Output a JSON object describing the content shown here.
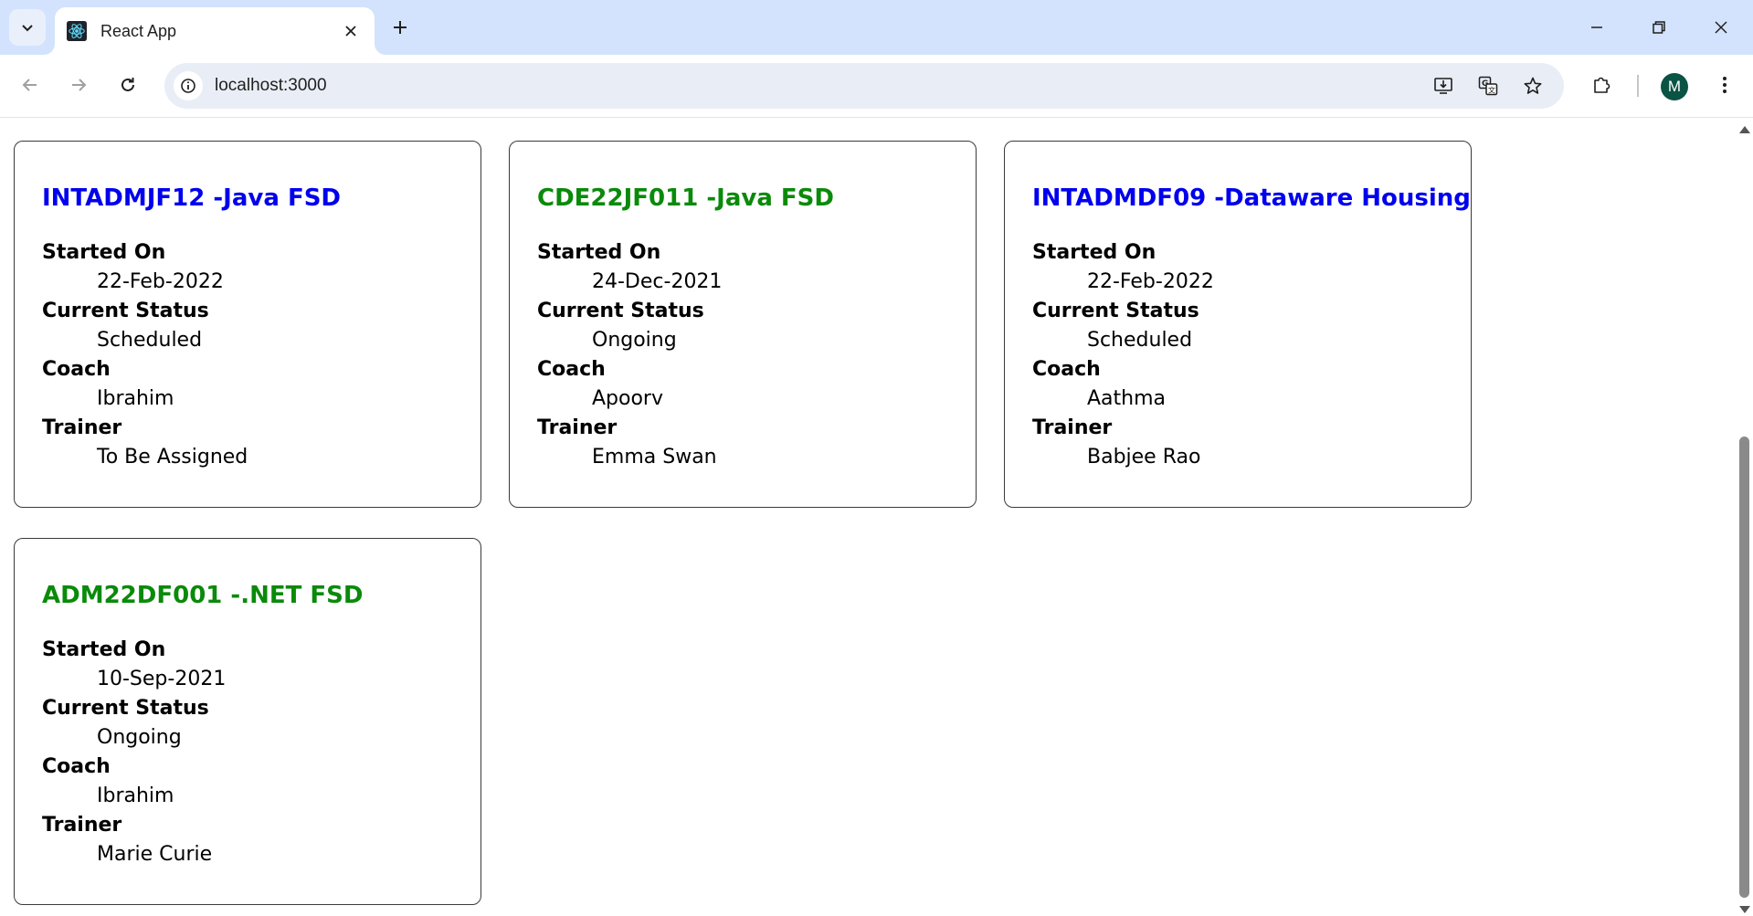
{
  "browser": {
    "tab": {
      "title": "React App",
      "favicon": "react-atom-icon"
    },
    "url": "localhost:3000",
    "profile_initial": "M",
    "colors": {
      "tabstrip": "#d3e3fd",
      "omnibox": "#e9eef6",
      "avatar": "#0b5345"
    }
  },
  "labels": {
    "started_on": "Started On",
    "current_status": "Current Status",
    "coach": "Coach",
    "trainer": "Trainer"
  },
  "cohorts": [
    {
      "code": "INTADMJF12",
      "title": "INTADMJF12 -Java FSD",
      "title_color": "#0000ee",
      "started_on": "22-Feb-2022",
      "status": "Scheduled",
      "coach": "Ibrahim",
      "trainer": "To Be Assigned"
    },
    {
      "code": "CDE22JF011",
      "title": "CDE22JF011 -Java FSD",
      "title_color": "#0a8a0a",
      "started_on": "24-Dec-2021",
      "status": "Ongoing",
      "coach": "Apoorv",
      "trainer": "Emma Swan"
    },
    {
      "code": "INTADMDF09",
      "title": "INTADMDF09 -Dataware Housing",
      "title_color": "#0000ee",
      "started_on": "22-Feb-2022",
      "status": "Scheduled",
      "coach": "Aathma",
      "trainer": "Babjee Rao"
    },
    {
      "code": "ADM22DF001",
      "title": "ADM22DF001 -.NET FSD",
      "title_color": "#0a8a0a",
      "started_on": "10-Sep-2021",
      "status": "Ongoing",
      "coach": "Ibrahim",
      "trainer": "Marie Curie"
    }
  ]
}
